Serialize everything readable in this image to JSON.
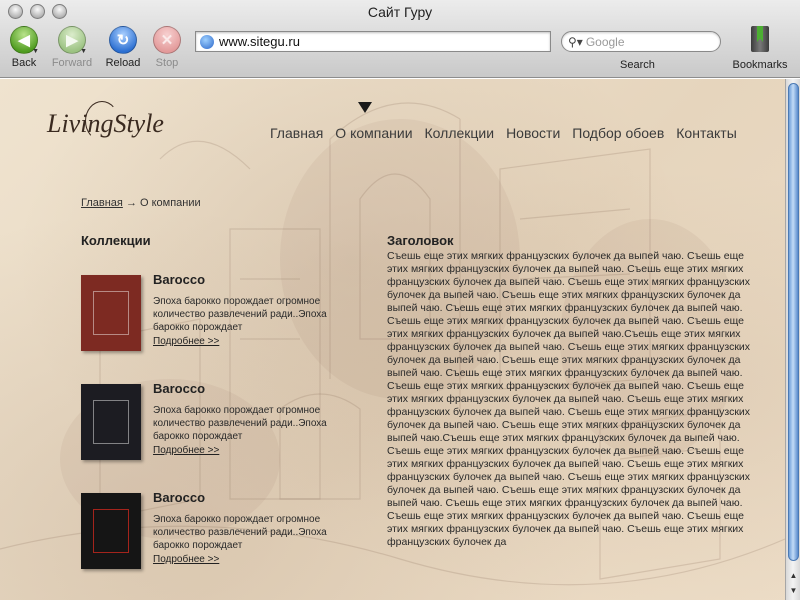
{
  "window": {
    "title": "Сайт Гуру"
  },
  "toolbar": {
    "back_label": "Back",
    "forward_label": "Forward",
    "reload_label": "Reload",
    "stop_label": "Stop",
    "search_label": "Search",
    "bookmarks_label": "Bookmarks"
  },
  "address": {
    "url": "www.sitegu.ru"
  },
  "search": {
    "placeholder": "Google"
  },
  "icons": {
    "back": "back-arrow-icon",
    "forward": "forward-arrow-icon",
    "reload": "reload-icon",
    "stop": "stop-x-icon",
    "site": "globe-icon",
    "search": "magnifier-icon",
    "bookmarks": "book-icon"
  },
  "site": {
    "logo_text": "LivingStyle",
    "nav": [
      {
        "label": "Главная"
      },
      {
        "label": "О компании"
      },
      {
        "label": "Коллекции"
      },
      {
        "label": "Новости"
      },
      {
        "label": "Подбор обоев"
      },
      {
        "label": "Контакты"
      }
    ],
    "breadcrumb": {
      "home": "Главная",
      "separator": "→",
      "current": "О компании"
    },
    "collections_heading": "Коллекции",
    "collections": [
      {
        "title": "Barocco",
        "description": "Эпоха барокко порождает огромное количество развлечений ради..Эпоха барокко порождает",
        "more": "Подробнее >>",
        "cover_color": "#7d2a22"
      },
      {
        "title": "Barocco",
        "description": "Эпоха барокко порождает огромное количество развлечений ради..Эпоха барокко порождает",
        "more": "Подробнее >>",
        "cover_color": "#1c1c22"
      },
      {
        "title": "Barocco",
        "description": "Эпоха барокко порождает огромное количество развлечений ради..Эпоха барокко порождает",
        "more": "Подробнее >>",
        "cover_color": "#151515"
      }
    ],
    "article": {
      "title": "Заголовок",
      "body": "Съешь еще этих мягких французских булочек да выпей чаю. Съешь еще этих мягких французских булочек да выпей чаю. Съешь еще этих мягких французских булочек да выпей чаю. Съешь еще этих мягких французских булочек да выпей чаю. Съешь еще этих мягких французских булочек да выпей чаю. Съешь еще этих мягких французских булочек да выпей чаю. Съешь еще этих мягких французских булочек да выпей чаю. Съешь еще этих мягких французских булочек да выпей чаю.Съешь еще этих мягких французских булочек да выпей чаю. Съешь еще этих мягких французских булочек да выпей чаю. Съешь еще этих мягких французских булочек да выпей чаю. Съешь еще этих мягких французских булочек да выпей чаю. Съешь еще этих мягких французских булочек да выпей чаю. Съешь еще этих мягких французских булочек да выпей чаю. Съешь еще этих мягких французских булочек да выпей чаю. Съешь еще этих мягких французских булочек да выпей чаю. Съешь еще этих мягких французских булочек да выпей чаю.Съешь еще этих мягких французских булочек да выпей чаю. Съешь еще этих мягких французских булочек да выпей чаю. Съешь еще этих мягких французских булочек да выпей чаю. Съешь еще этих мягких французских булочек да выпей чаю. Съешь еще этих мягких французских булочек да выпей чаю. Съешь еще этих мягких французских булочек да выпей чаю. Съешь еще этих мягких французских булочек да выпей чаю. Съешь еще этих мягких французских булочек да выпей чаю. Съешь еще этих мягких французских булочек да выпей чаю. Съешь еще этих мягких французских булочек да"
    }
  }
}
